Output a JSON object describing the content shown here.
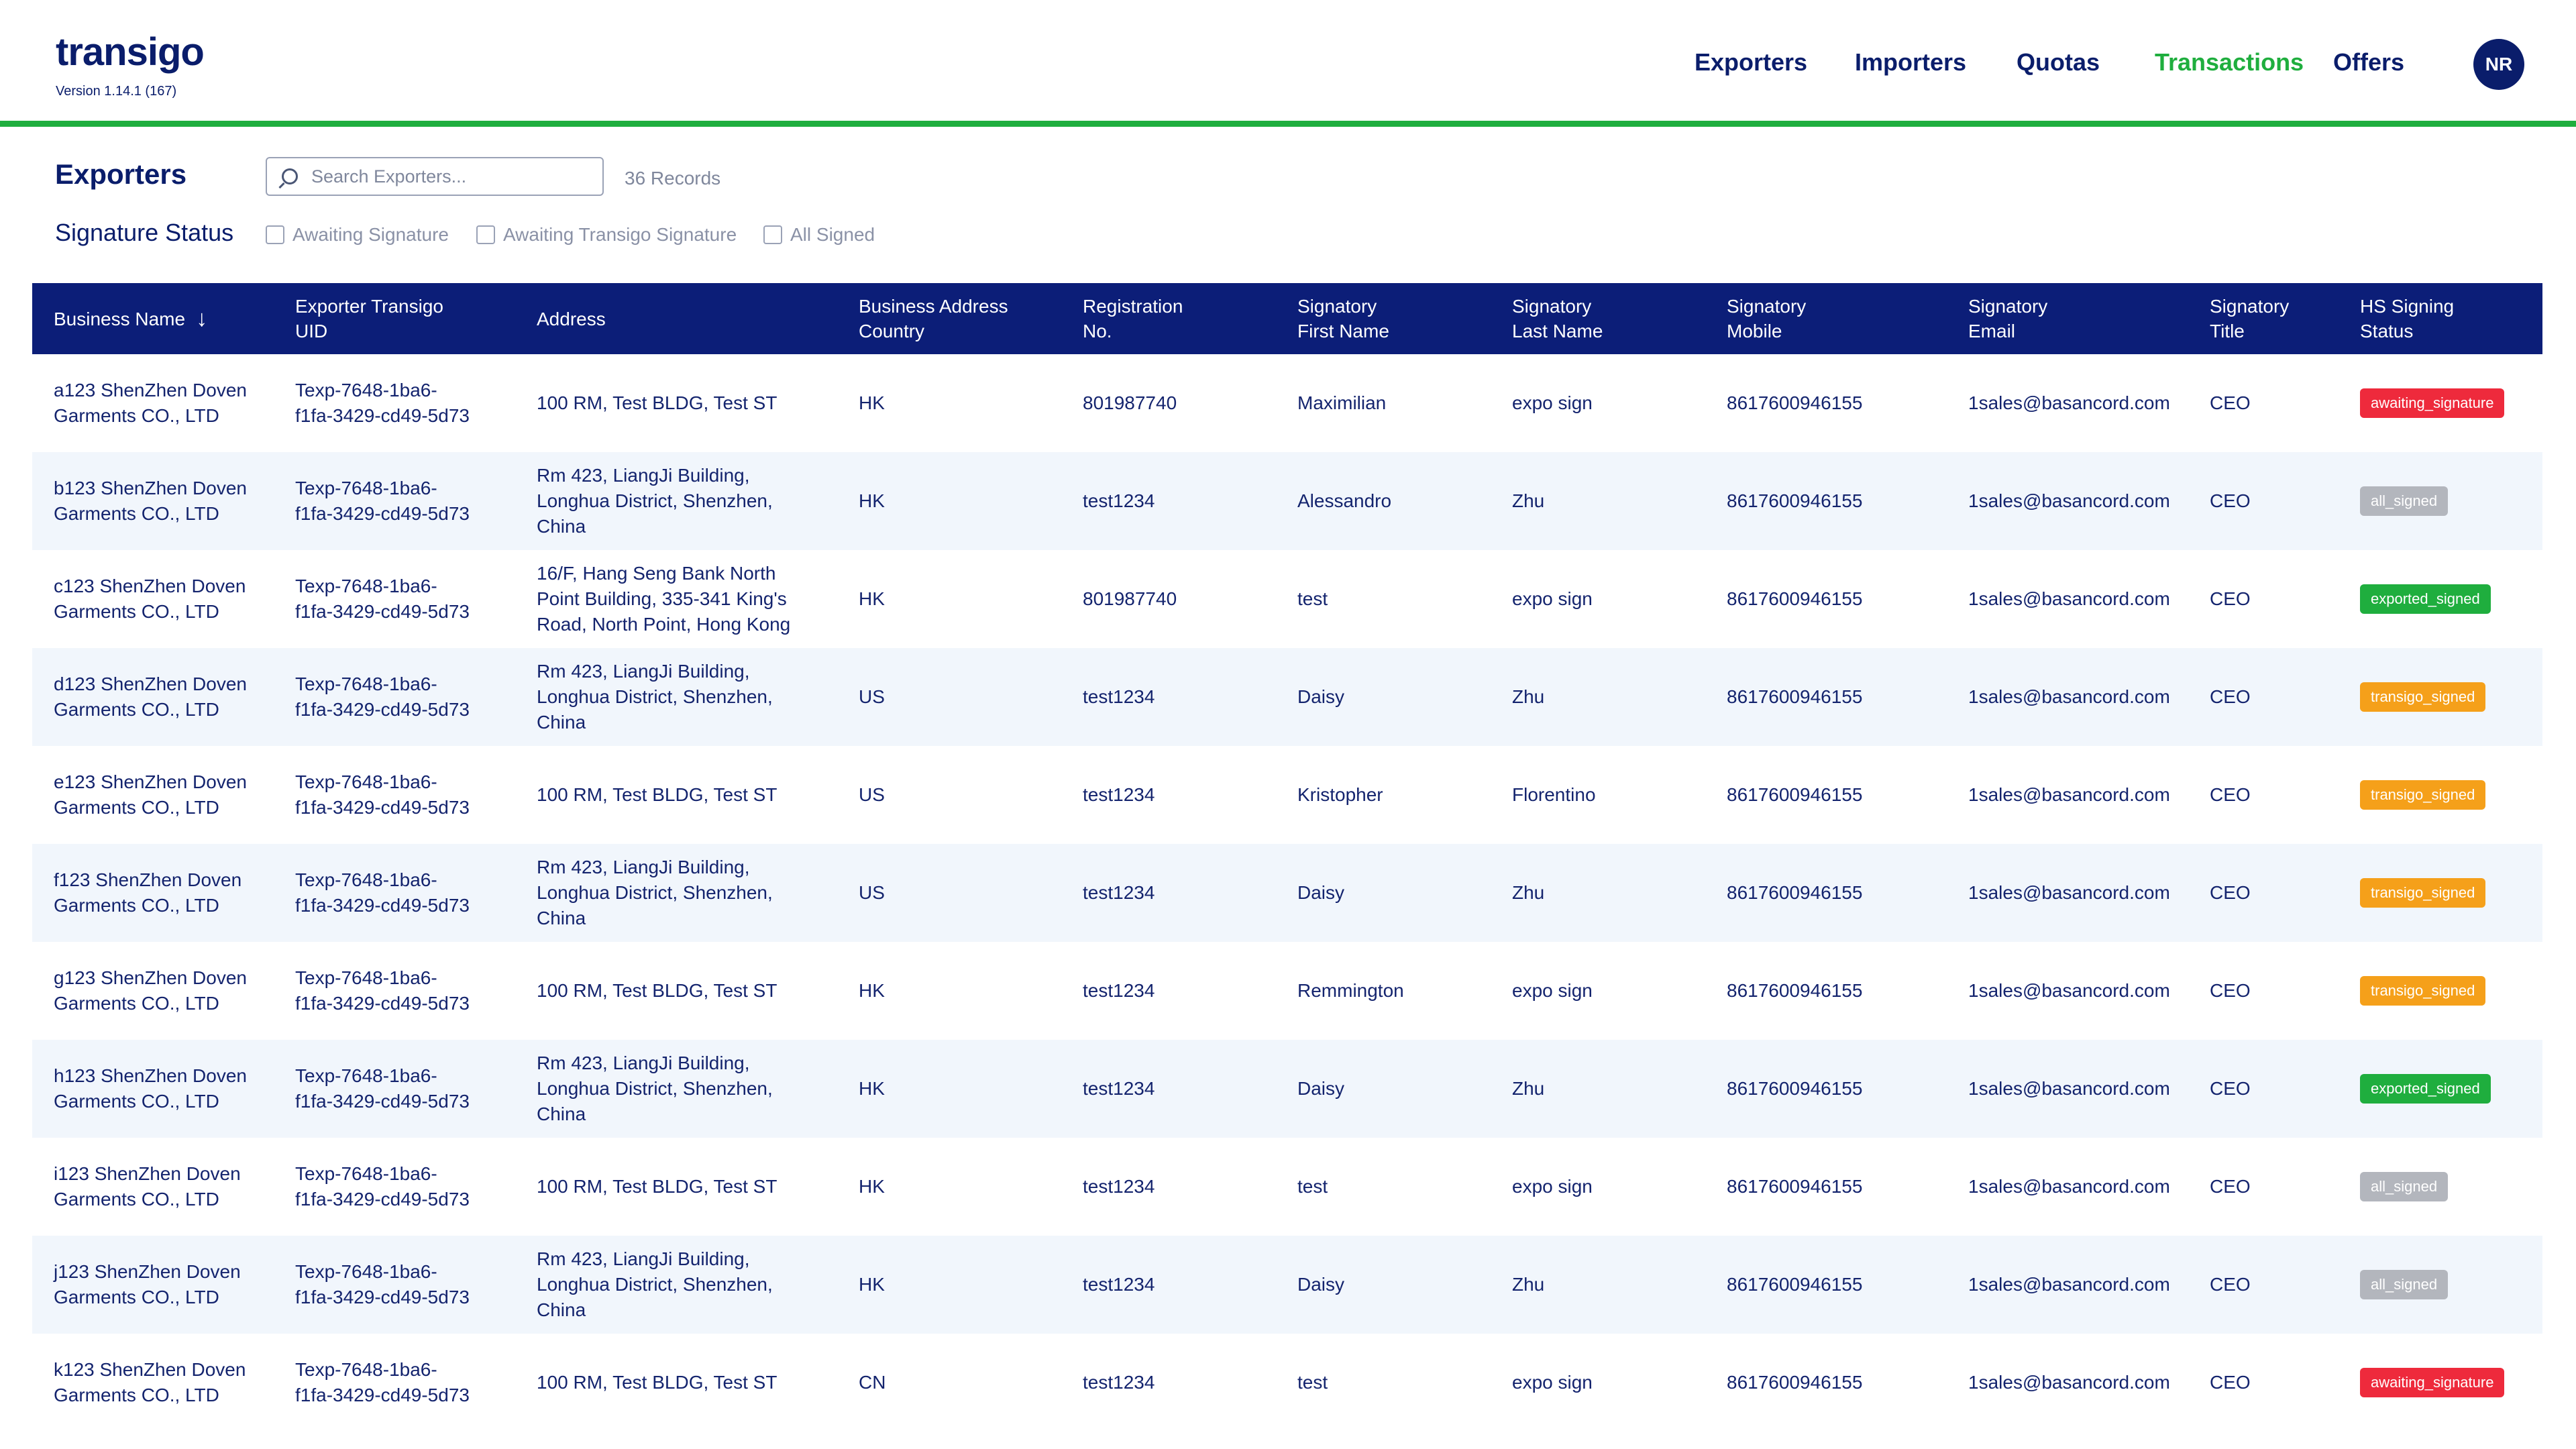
{
  "app": {
    "logo_text": "transigo",
    "version": "Version 1.14.1 (167)"
  },
  "nav": {
    "exporters": "Exporters",
    "importers": "Importers",
    "quotas": "Quotas",
    "transactions": "Transactions",
    "offers": "Offers",
    "avatar_initials": "NR",
    "active": "Transactions"
  },
  "filters": {
    "title": "Exporters",
    "search_placeholder": "Search Exporters...",
    "search_value": "",
    "records": "36 Records",
    "signature_status_label": "Signature Status",
    "awaiting_signature": "Awaiting Signature",
    "awaiting_transigo_signature": "Awaiting Transigo Signature",
    "all_signed": "All Signed"
  },
  "table": {
    "sort_icon": "arrow-down-icon",
    "headers": {
      "business_name": "Business Name",
      "uid_l1": "Exporter Transigo",
      "uid_l2": "UID",
      "address": "Address",
      "country_l1": "Business Address",
      "country_l2": "Country",
      "reg_l1": "Registration",
      "reg_l2": "No.",
      "first_l1": "Signatory",
      "first_l2": "First Name",
      "last_l1": "Signatory",
      "last_l2": "Last Name",
      "mobile_l1": "Signatory",
      "mobile_l2": "Mobile",
      "email_l1": "Signatory",
      "email_l2": "Email",
      "title_l1": "Signatory",
      "title_l2": "Title",
      "status_l1": "HS Signing",
      "status_l2": "Status"
    },
    "rows": [
      {
        "name1": "a123 ShenZhen Doven",
        "name2": "Garments CO., LTD",
        "uid1": "Texp-7648-1ba6-",
        "uid2": "f1fa-3429-cd49-5d73",
        "addr1": "100 RM, Test BLDG, Test ST",
        "addr2": "",
        "addr3": "",
        "country": "HK",
        "reg": "801987740",
        "first": "Maximilian",
        "last": "expo sign",
        "mobile": "8617600946155",
        "email": "1sales@basancord.com",
        "title": "CEO",
        "status": "awaiting_signature"
      },
      {
        "name1": "b123 ShenZhen Doven",
        "name2": "Garments CO., LTD",
        "uid1": "Texp-7648-1ba6-",
        "uid2": "f1fa-3429-cd49-5d73",
        "addr1": "Rm 423, LiangJi Building,",
        "addr2": "Longhua District, Shenzhen,",
        "addr3": "China",
        "country": "HK",
        "reg": "test1234",
        "first": "Alessandro",
        "last": "Zhu",
        "mobile": "8617600946155",
        "email": "1sales@basancord.com",
        "title": "CEO",
        "status": "all_signed"
      },
      {
        "name1": "c123 ShenZhen Doven",
        "name2": "Garments CO., LTD",
        "uid1": "Texp-7648-1ba6-",
        "uid2": "f1fa-3429-cd49-5d73",
        "addr1": "16/F, Hang Seng Bank North",
        "addr2": "Point Building, 335-341 King's",
        "addr3": "Road, North Point, Hong Kong",
        "country": "HK",
        "reg": "801987740",
        "first": "test",
        "last": "expo sign",
        "mobile": "8617600946155",
        "email": "1sales@basancord.com",
        "title": "CEO",
        "status": "exported_signed"
      },
      {
        "name1": "d123 ShenZhen Doven",
        "name2": "Garments CO., LTD",
        "uid1": "Texp-7648-1ba6-",
        "uid2": "f1fa-3429-cd49-5d73",
        "addr1": "Rm 423, LiangJi Building,",
        "addr2": "Longhua District, Shenzhen,",
        "addr3": "China",
        "country": "US",
        "reg": "test1234",
        "first": "Daisy",
        "last": "Zhu",
        "mobile": "8617600946155",
        "email": "1sales@basancord.com",
        "title": "CEO",
        "status": "transigo_signed"
      },
      {
        "name1": "e123 ShenZhen Doven",
        "name2": "Garments CO., LTD",
        "uid1": "Texp-7648-1ba6-",
        "uid2": "f1fa-3429-cd49-5d73",
        "addr1": "100 RM, Test BLDG, Test ST",
        "addr2": "",
        "addr3": "",
        "country": "US",
        "reg": "test1234",
        "first": "Kristopher",
        "last": "Florentino",
        "mobile": "8617600946155",
        "email": "1sales@basancord.com",
        "title": "CEO",
        "status": "transigo_signed"
      },
      {
        "name1": "f123 ShenZhen Doven",
        "name2": "Garments CO., LTD",
        "uid1": "Texp-7648-1ba6-",
        "uid2": "f1fa-3429-cd49-5d73",
        "addr1": "Rm 423, LiangJi Building,",
        "addr2": "Longhua District, Shenzhen,",
        "addr3": "China",
        "country": "US",
        "reg": "test1234",
        "first": "Daisy",
        "last": "Zhu",
        "mobile": "8617600946155",
        "email": "1sales@basancord.com",
        "title": "CEO",
        "status": "transigo_signed"
      },
      {
        "name1": "g123 ShenZhen Doven",
        "name2": "Garments CO., LTD",
        "uid1": "Texp-7648-1ba6-",
        "uid2": "f1fa-3429-cd49-5d73",
        "addr1": "100 RM, Test BLDG, Test ST",
        "addr2": "",
        "addr3": "",
        "country": "HK",
        "reg": "test1234",
        "first": "Remmington",
        "last": "expo sign",
        "mobile": "8617600946155",
        "email": "1sales@basancord.com",
        "title": "CEO",
        "status": "transigo_signed"
      },
      {
        "name1": "h123 ShenZhen Doven",
        "name2": "Garments CO., LTD",
        "uid1": "Texp-7648-1ba6-",
        "uid2": "f1fa-3429-cd49-5d73",
        "addr1": "Rm 423, LiangJi Building,",
        "addr2": "Longhua District, Shenzhen,",
        "addr3": "China",
        "country": "HK",
        "reg": "test1234",
        "first": "Daisy",
        "last": "Zhu",
        "mobile": "8617600946155",
        "email": "1sales@basancord.com",
        "title": "CEO",
        "status": "exported_signed"
      },
      {
        "name1": "i123 ShenZhen Doven",
        "name2": "Garments CO., LTD",
        "uid1": "Texp-7648-1ba6-",
        "uid2": "f1fa-3429-cd49-5d73",
        "addr1": "100 RM, Test BLDG, Test ST",
        "addr2": "",
        "addr3": "",
        "country": "HK",
        "reg": "test1234",
        "first": "test",
        "last": "expo sign",
        "mobile": "8617600946155",
        "email": "1sales@basancord.com",
        "title": "CEO",
        "status": "all_signed"
      },
      {
        "name1": "j123 ShenZhen Doven",
        "name2": "Garments CO., LTD",
        "uid1": "Texp-7648-1ba6-",
        "uid2": "f1fa-3429-cd49-5d73",
        "addr1": "Rm 423, LiangJi Building,",
        "addr2": "Longhua District, Shenzhen,",
        "addr3": "China",
        "country": "HK",
        "reg": "test1234",
        "first": "Daisy",
        "last": "Zhu",
        "mobile": "8617600946155",
        "email": "1sales@basancord.com",
        "title": "CEO",
        "status": "all_signed"
      },
      {
        "name1": "k123 ShenZhen Doven",
        "name2": "Garments CO., LTD",
        "uid1": "Texp-7648-1ba6-",
        "uid2": "f1fa-3429-cd49-5d73",
        "addr1": "100 RM, Test BLDG, Test ST",
        "addr2": "",
        "addr3": "",
        "country": "CN",
        "reg": "test1234",
        "first": "test",
        "last": "expo sign",
        "mobile": "8617600946155",
        "email": "1sales@basancord.com",
        "title": "CEO",
        "status": "awaiting_signature"
      }
    ]
  },
  "status_colors": {
    "awaiting_signature": "#ee2a3c",
    "all_signed": "#b3b6bd",
    "exported_signed": "#1fae3e",
    "transigo_signed": "#f5a01a"
  },
  "colors": {
    "navy": "#0c1e78",
    "green": "#1fae3e",
    "row_alt": "#f1f6fc"
  }
}
